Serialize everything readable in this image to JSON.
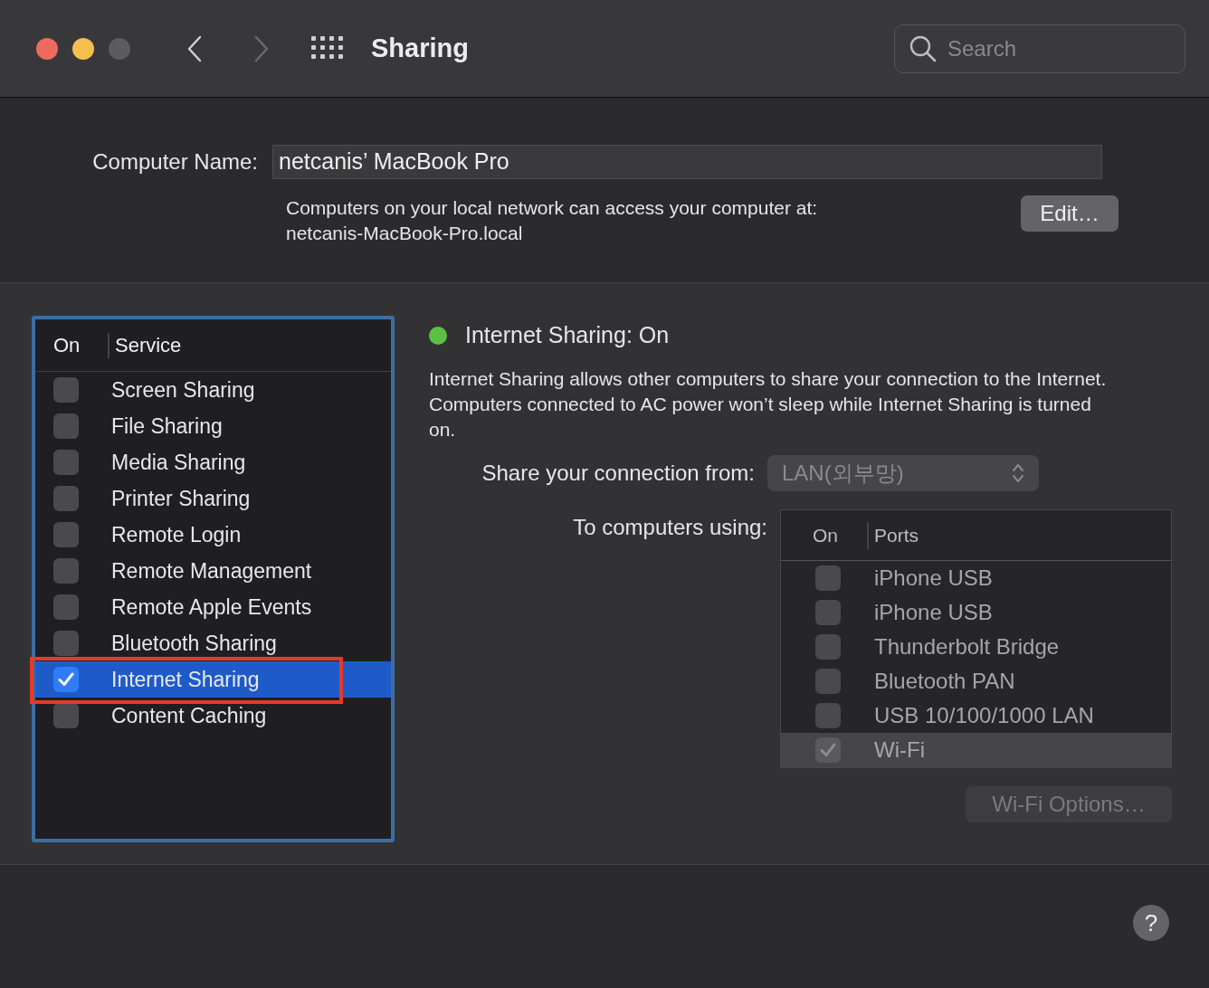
{
  "window": {
    "title": "Sharing",
    "search": {
      "placeholder": "Search"
    }
  },
  "computer_name": {
    "label": "Computer Name:",
    "value": "netcanis’ MacBook Pro",
    "note": "Computers on your local network can access your computer at:",
    "address": "netcanis-MacBook-Pro.local",
    "edit_button": "Edit…"
  },
  "services": {
    "columns": [
      "On",
      "Service"
    ],
    "rows": [
      {
        "label": "Screen Sharing",
        "checked": false,
        "selected": false,
        "annotated": false
      },
      {
        "label": "File Sharing",
        "checked": false,
        "selected": false,
        "annotated": false
      },
      {
        "label": "Media Sharing",
        "checked": false,
        "selected": false,
        "annotated": false
      },
      {
        "label": "Printer Sharing",
        "checked": false,
        "selected": false,
        "annotated": false
      },
      {
        "label": "Remote Login",
        "checked": false,
        "selected": false,
        "annotated": false
      },
      {
        "label": "Remote Management",
        "checked": false,
        "selected": false,
        "annotated": false
      },
      {
        "label": "Remote Apple Events",
        "checked": false,
        "selected": false,
        "annotated": false
      },
      {
        "label": "Bluetooth Sharing",
        "checked": false,
        "selected": false,
        "annotated": false
      },
      {
        "label": "Internet Sharing",
        "checked": true,
        "selected": true,
        "annotated": true
      },
      {
        "label": "Content Caching",
        "checked": false,
        "selected": false,
        "annotated": false
      }
    ]
  },
  "status": {
    "title": "Internet Sharing: On",
    "on": true,
    "description": "Internet Sharing allows other computers to share your connection to the Internet. Computers connected to AC power won’t sleep while Internet Sharing is turned on."
  },
  "share_from": {
    "label": "Share your connection from:",
    "value": "LAN(외부망)",
    "disabled": true
  },
  "to_computers": {
    "label": "To computers using:",
    "columns": [
      "On",
      "Ports"
    ],
    "disabled": true,
    "rows": [
      {
        "label": "iPhone USB",
        "checked": false,
        "selected": false
      },
      {
        "label": "iPhone USB",
        "checked": false,
        "selected": false
      },
      {
        "label": "Thunderbolt Bridge",
        "checked": false,
        "selected": false
      },
      {
        "label": "Bluetooth PAN",
        "checked": false,
        "selected": false
      },
      {
        "label": "USB 10/100/1000 LAN",
        "checked": false,
        "selected": false
      },
      {
        "label": "Wi-Fi",
        "checked": true,
        "selected": true
      }
    ]
  },
  "wifi_options_button": {
    "label": "Wi-Fi Options…",
    "disabled": true
  },
  "help_button": "?"
}
